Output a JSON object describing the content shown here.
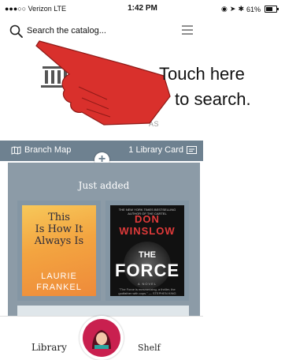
{
  "status_bar": {
    "carrier": "●●●○○ Verizon  LTE",
    "time": "1:42 PM",
    "battery": "61%"
  },
  "search": {
    "placeholder": "Search the catalog..."
  },
  "callout": {
    "line1": "Touch here",
    "line2": "to search."
  },
  "logo": {
    "suffix_text": "AS"
  },
  "library_bar": {
    "branch_map": "Branch Map",
    "library_card": "1 Library Card"
  },
  "main": {
    "section_title": "Just added",
    "books": [
      {
        "title_lines": [
          "This",
          "Is How It",
          "Always Is"
        ],
        "author_lines": [
          "LAURIE",
          "FRANKEL"
        ]
      },
      {
        "blurb": "THE NEW YORK TIMES BESTSELLING AUTHOR OF THE CARTEL",
        "author_first": "DON",
        "author_last": "WINSLOW",
        "title_the": "THE",
        "title_main": "FORCE",
        "subtitle": "A NOVEL",
        "quote": "\"The Force is mesmerizing, a thriller, the godfather with cops.\" — STEPHEN KING"
      }
    ]
  },
  "tab_bar": {
    "library": "Library",
    "shelf": "Shelf"
  },
  "colors": {
    "bar": "#6e8190",
    "panel": "#8c9ba7",
    "hand": "#d9302c",
    "avatar": "#c9204f"
  }
}
